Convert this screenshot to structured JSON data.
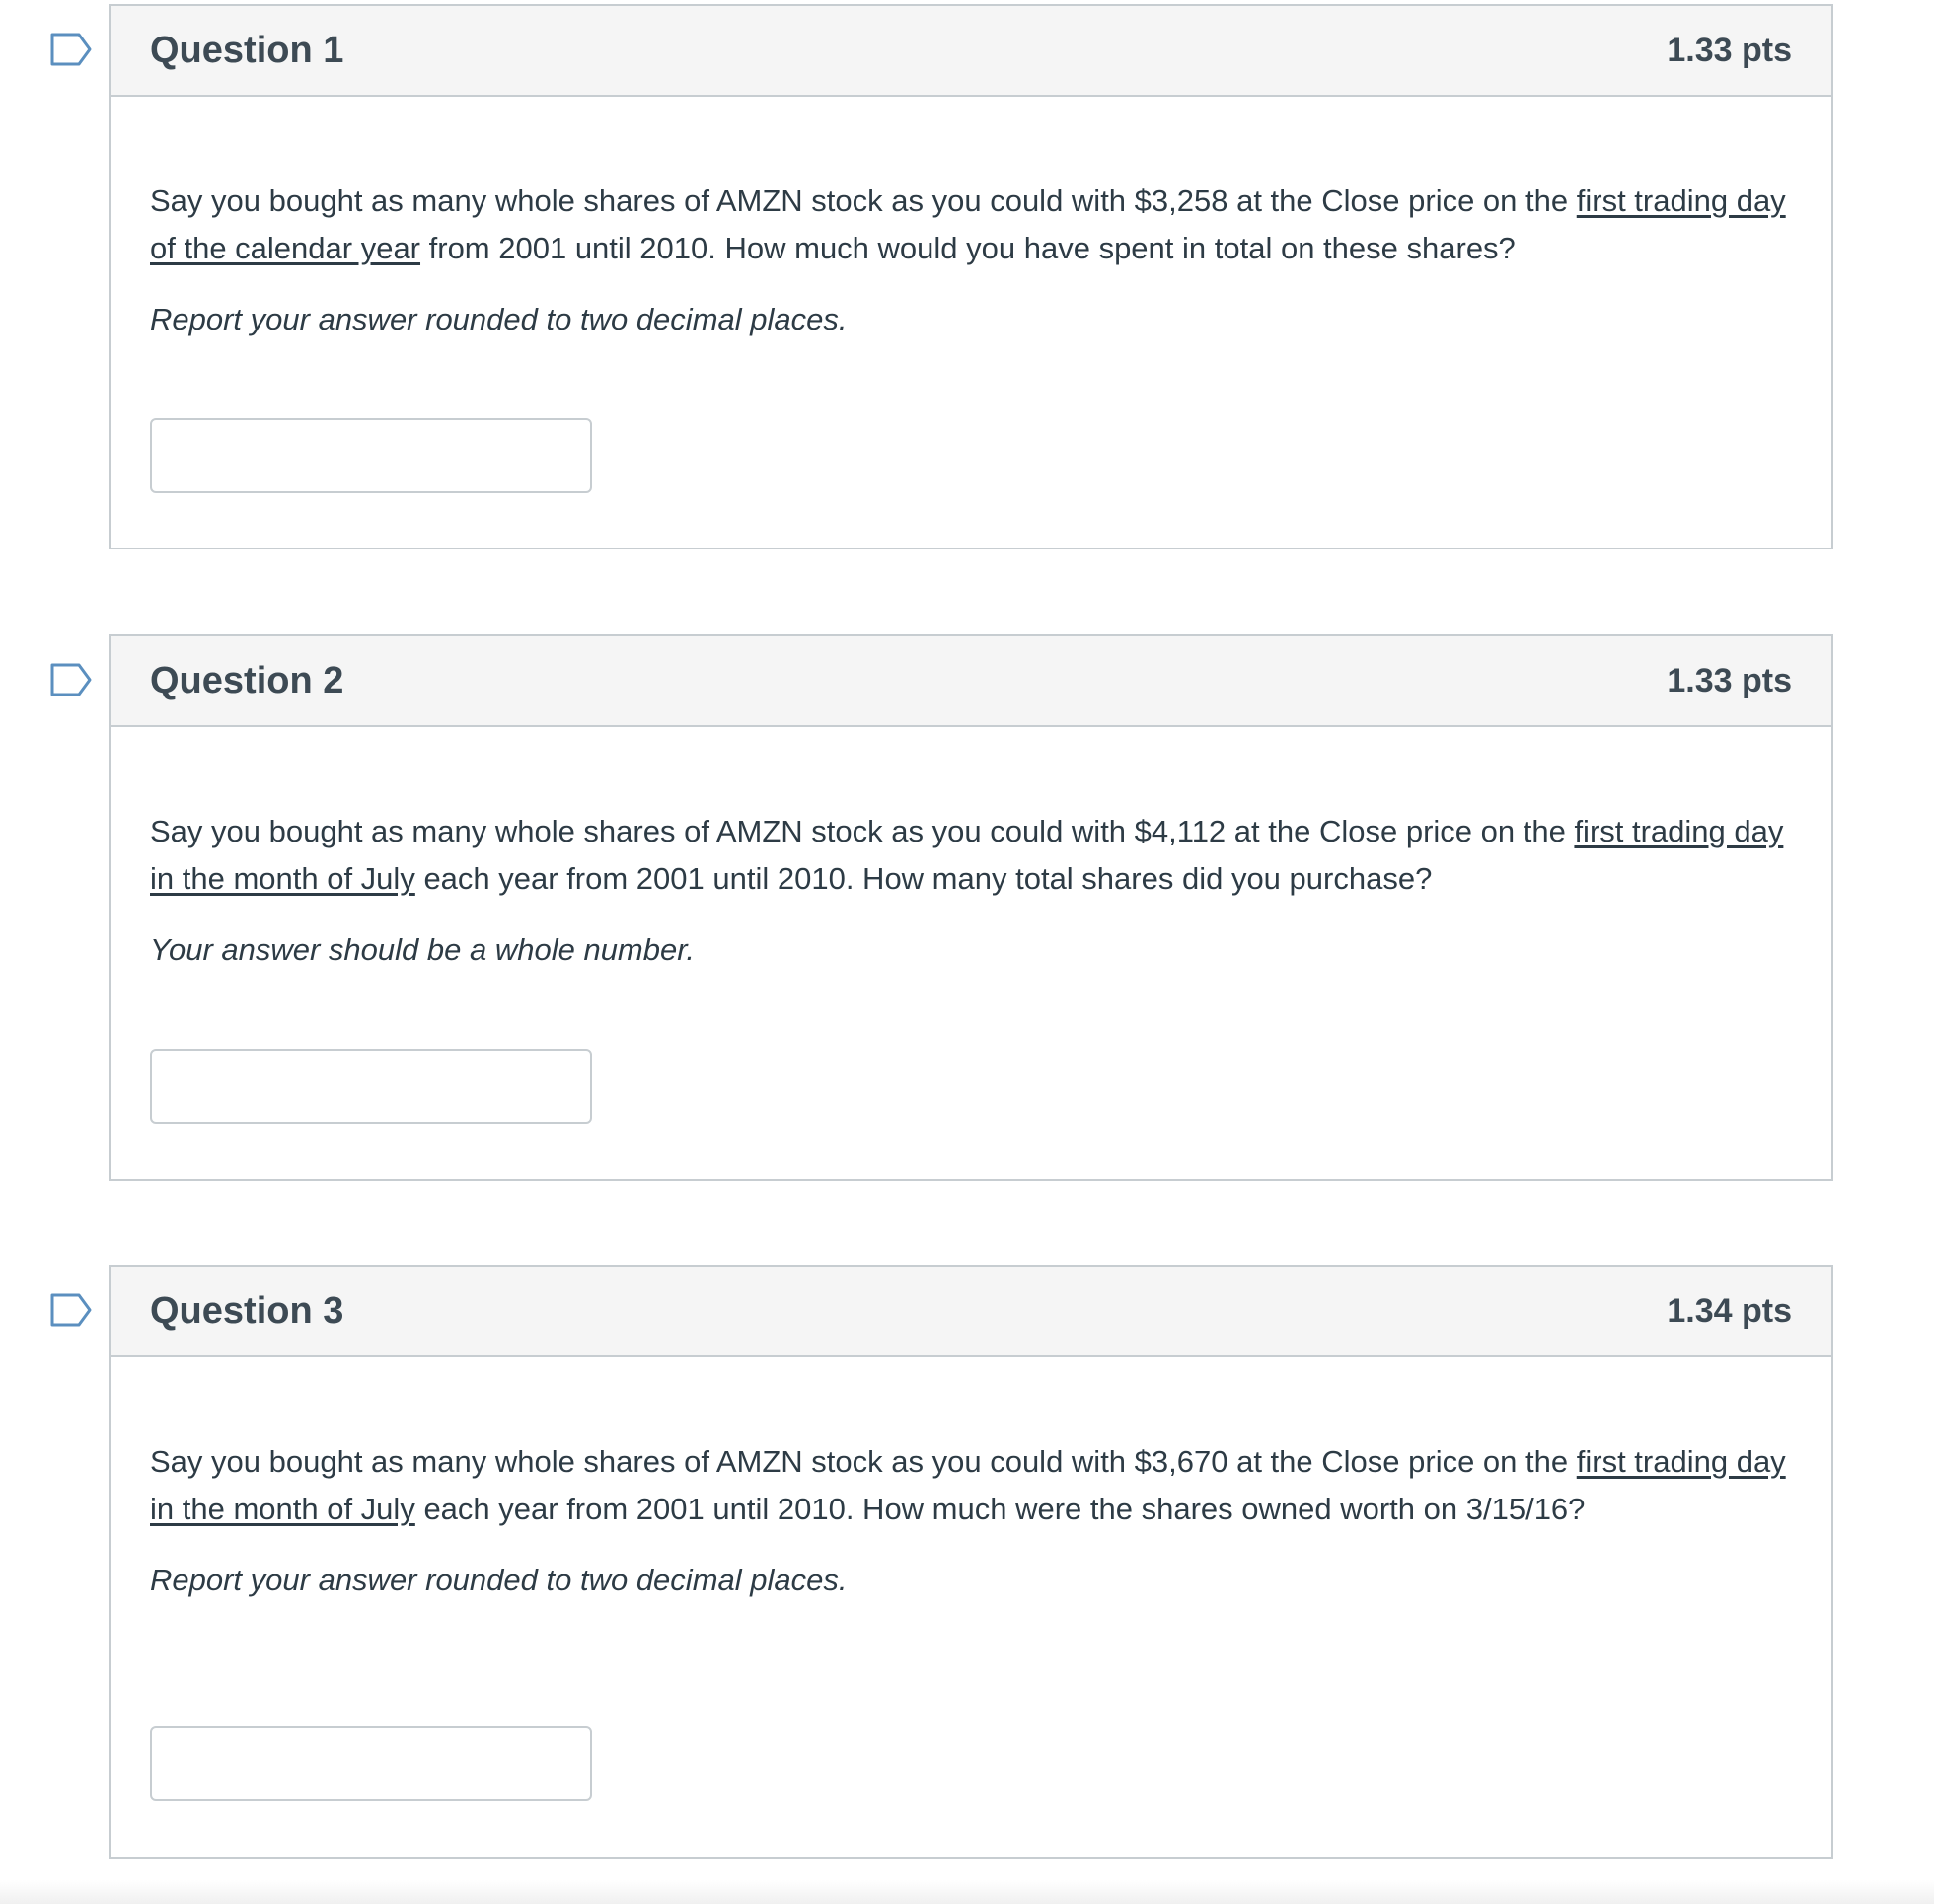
{
  "questions": [
    {
      "title": "Question 1",
      "points": "1.33 pts",
      "text_before": "Say you bought as many whole shares of AMZN stock as you could with $3,258 at the Close price on the ",
      "text_underlined": "first trading day of the calendar year",
      "text_after": " from 2001 until 2010. How much would you have spent in total on these shares?",
      "hint": "Report your answer rounded to two decimal places.",
      "answer_value": ""
    },
    {
      "title": "Question 2",
      "points": "1.33 pts",
      "text_before": "Say you bought as many whole shares of AMZN stock as you could with $4,112 at the Close price on the ",
      "text_underlined": "first trading day in the month of July",
      "text_after": " each year from 2001 until 2010. How many total shares did you purchase?",
      "hint": "Your answer should be a whole number.",
      "answer_value": ""
    },
    {
      "title": "Question 3",
      "points": "1.34 pts",
      "text_before": "Say you bought as many whole shares of AMZN stock as you could with $3,670 at the Close price on the ",
      "text_underlined": "first trading day in the month of July",
      "text_after": " each year from 2001 until 2010. How much were the shares owned worth on 3/15/16?",
      "hint": "Report your answer rounded to two decimal places.",
      "answer_value": ""
    }
  ],
  "colors": {
    "flag_outline": "#5b8fbf",
    "header_bg": "#f5f5f5",
    "border": "#c7cdd1",
    "text": "#2d3b45"
  },
  "icons": {
    "flag": "bookmark-flag-icon"
  }
}
